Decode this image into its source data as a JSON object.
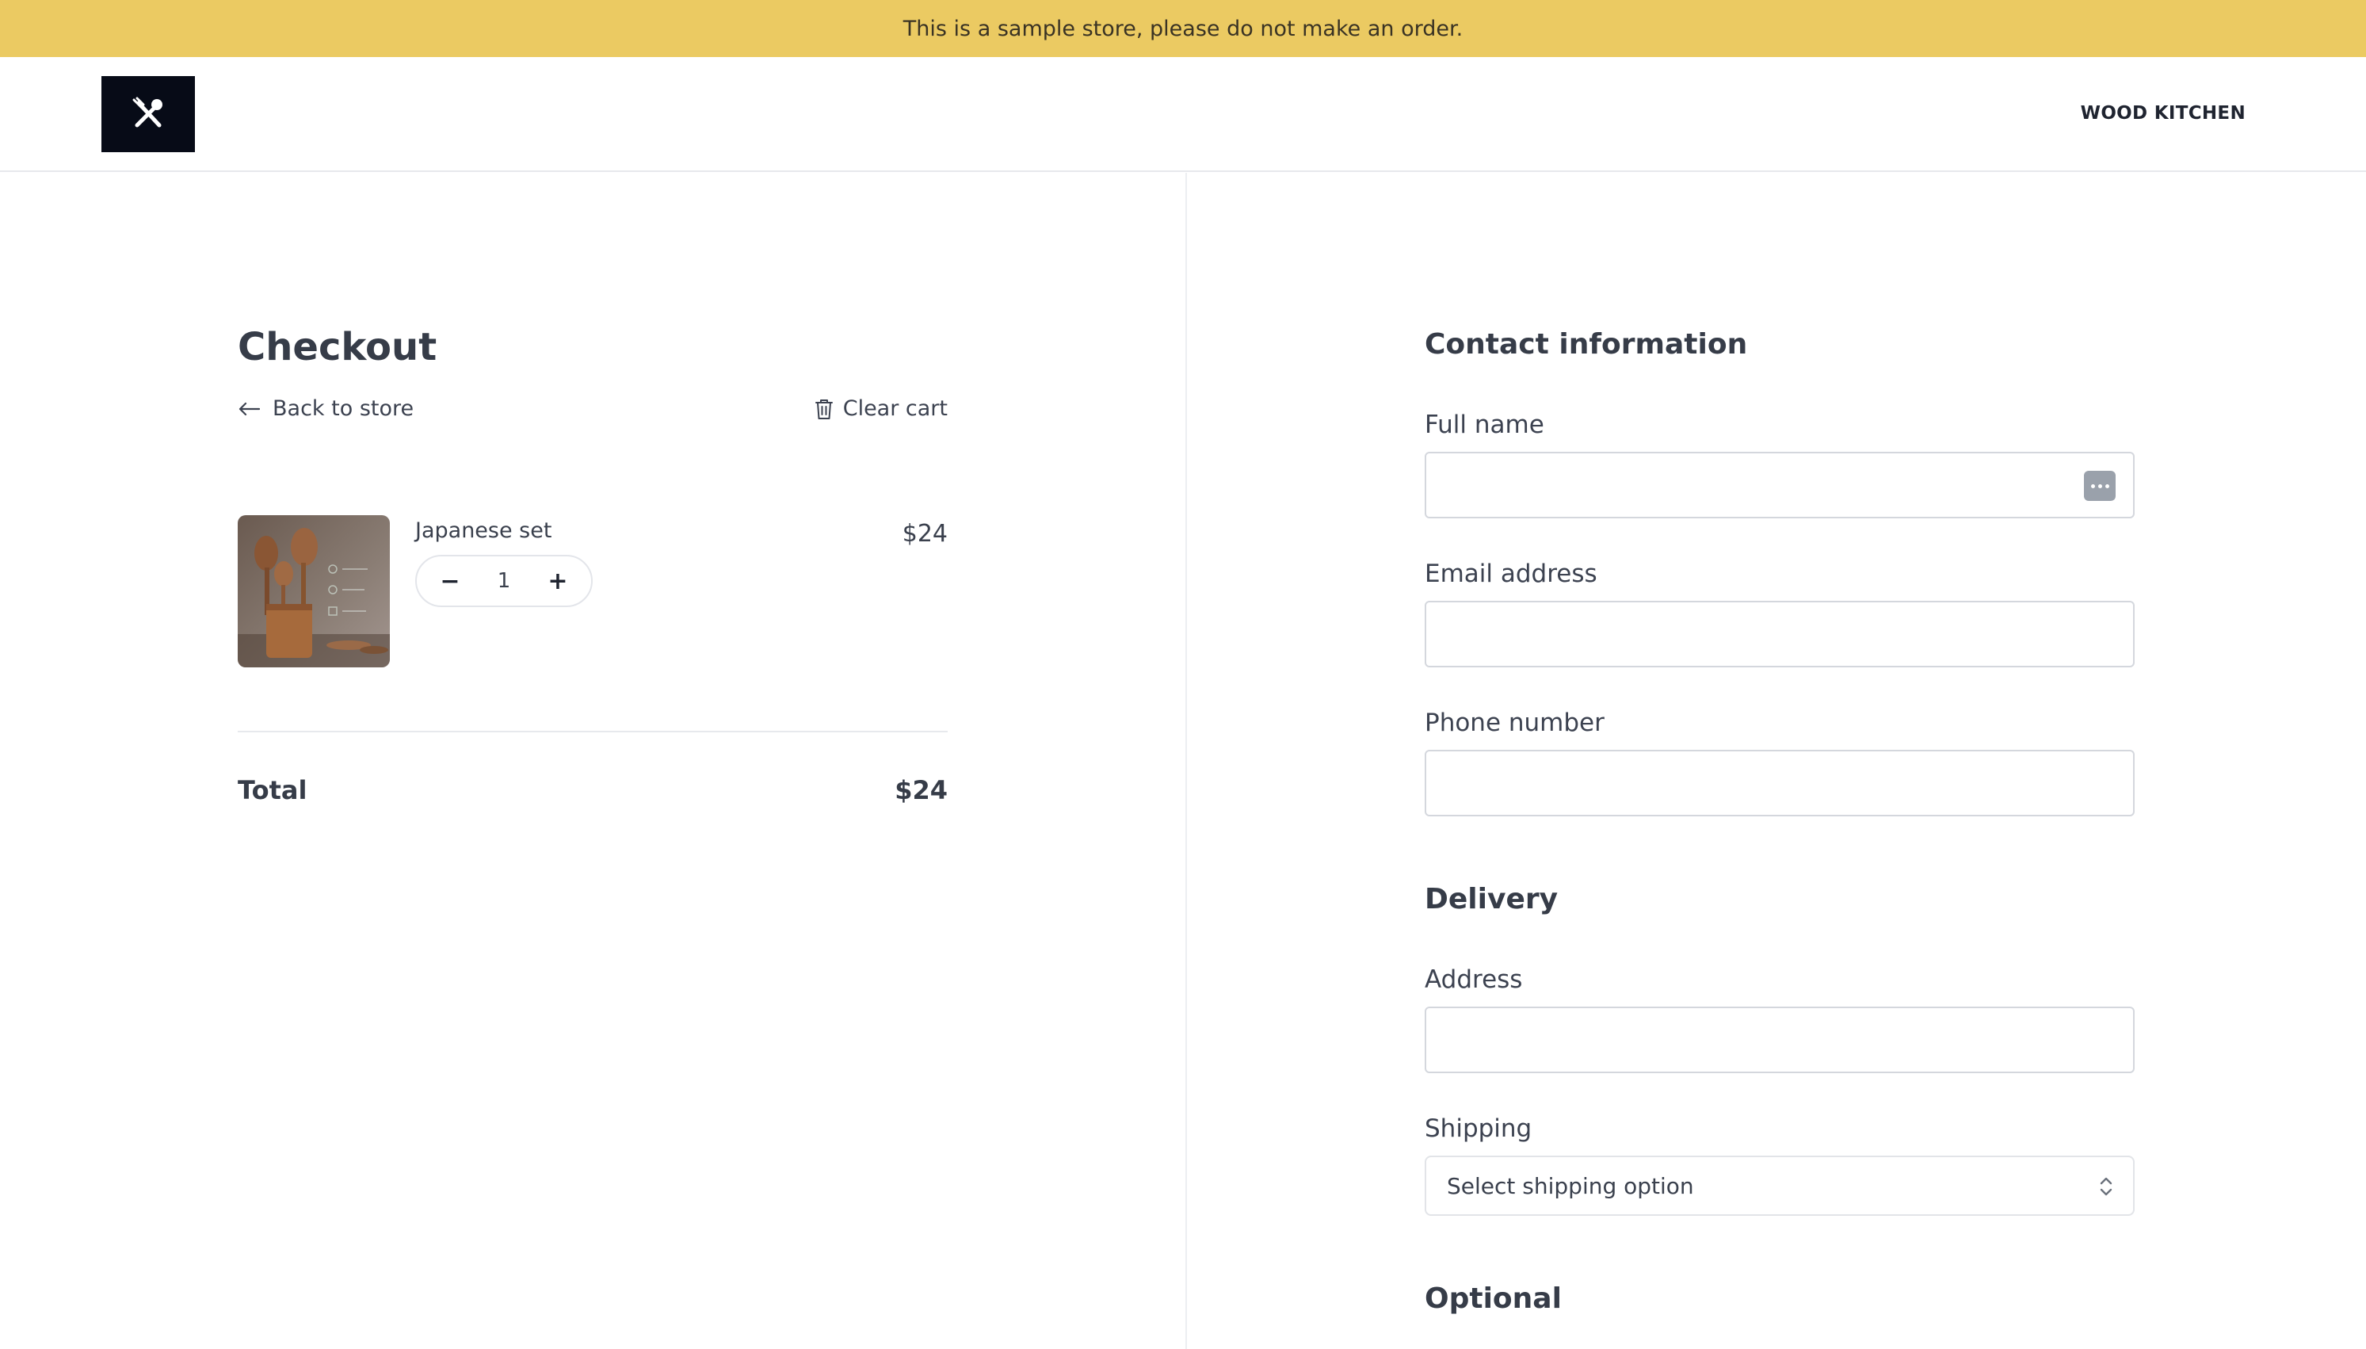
{
  "banner": {
    "text": "This is a sample store, please do not make an order."
  },
  "header": {
    "logo_icon": "utensils-icon",
    "store_name": "WOOD KITCHEN"
  },
  "cart": {
    "title": "Checkout",
    "back_label": "Back to store",
    "clear_label": "Clear cart",
    "items": [
      {
        "name": "Japanese set",
        "price": "$24",
        "quantity": "1",
        "decrement": "−",
        "increment": "+"
      }
    ],
    "total_label": "Total",
    "total_value": "$24"
  },
  "form": {
    "contact_heading": "Contact information",
    "full_name_label": "Full name",
    "full_name_value": "",
    "email_label": "Email address",
    "email_value": "",
    "phone_label": "Phone number",
    "phone_value": "",
    "delivery_heading": "Delivery",
    "address_label": "Address",
    "address_value": "",
    "shipping_label": "Shipping",
    "shipping_selected": "Select shipping option",
    "optional_heading": "Optional"
  },
  "colors": {
    "banner": "#ebca62",
    "logo_bg": "#070b17",
    "text": "#363c48"
  }
}
